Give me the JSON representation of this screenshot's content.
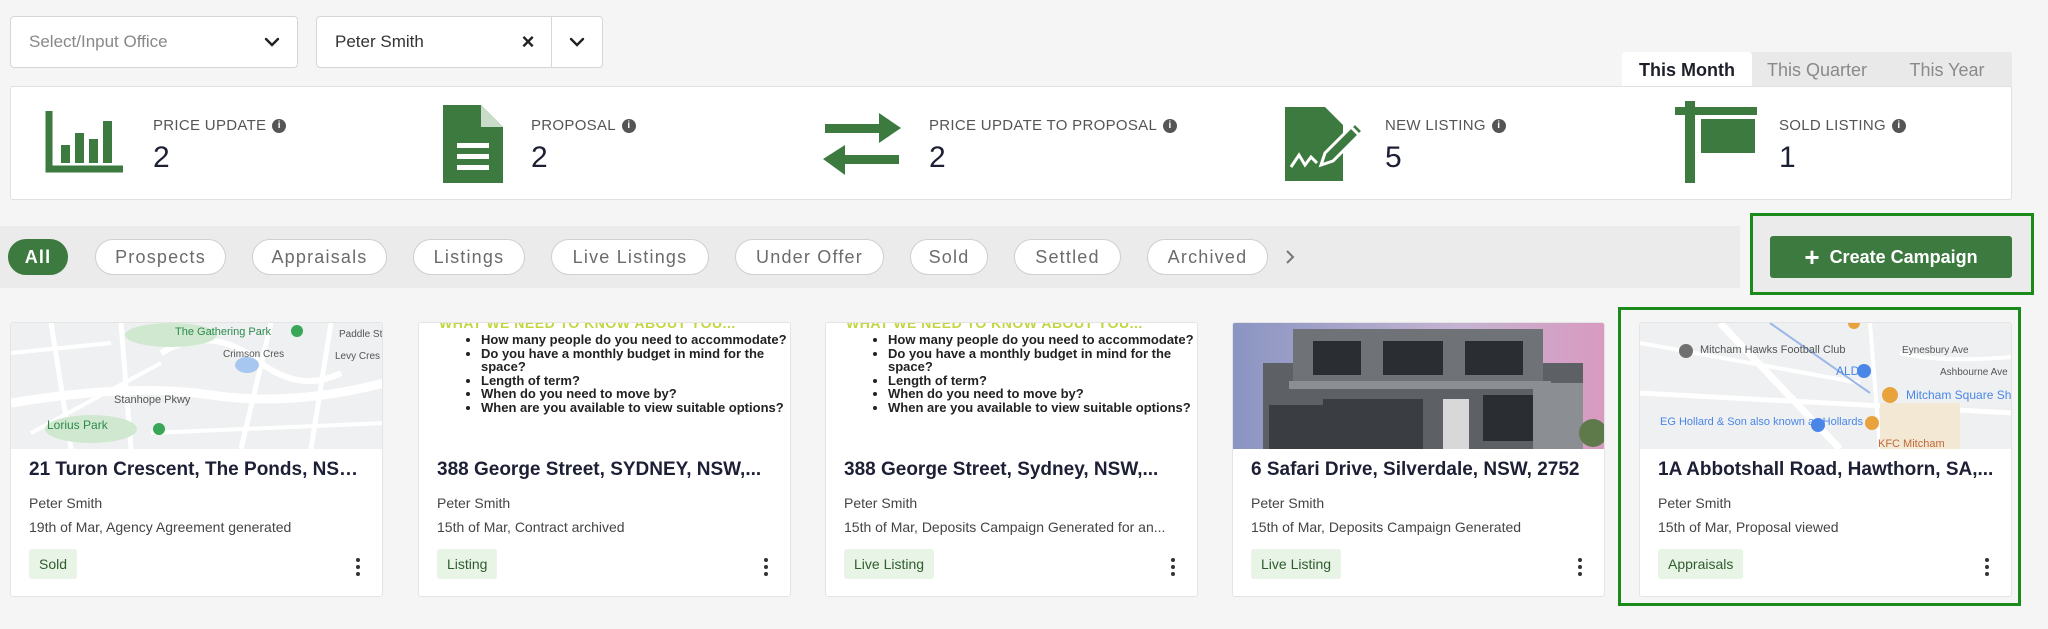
{
  "filters": {
    "office_placeholder": "Select/Input Office",
    "agent_value": "Peter Smith"
  },
  "period_tabs": [
    "This Month",
    "This Quarter",
    "This Year"
  ],
  "stats": [
    {
      "label": "PRICE UPDATE",
      "value": "2",
      "icon": "bar-chart-icon"
    },
    {
      "label": "PROPOSAL",
      "value": "2",
      "icon": "document-icon"
    },
    {
      "label": "PRICE UPDATE TO PROPOSAL",
      "value": "2",
      "icon": "swap-arrows-icon"
    },
    {
      "label": "NEW LISTING",
      "value": "5",
      "icon": "signature-doc-icon"
    },
    {
      "label": "SOLD LISTING",
      "value": "1",
      "icon": "sign-post-icon"
    }
  ],
  "status_tabs": [
    "All",
    "Prospects",
    "Appraisals",
    "Listings",
    "Live Listings",
    "Under Offer",
    "Sold",
    "Settled",
    "Archived"
  ],
  "create_campaign_label": "Create Campaign",
  "doc_thumb": {
    "heading": "WHAT WE NEED TO KNOW ABOUT YOU...",
    "bullets": [
      "How many people do you need to accommodate?",
      "Do you have a monthly budget in mind for the space?",
      "Length of term?",
      "When do you need to move by?",
      "When are you available to view suitable options?"
    ]
  },
  "map1_labels": {
    "park": "The Gathering Park",
    "street1": "Stanhope Pkwy",
    "park2": "Lorius Park",
    "cres": "Crimson Cres",
    "levy": "Levy Cres",
    "paddle": "Paddle St"
  },
  "map2_labels": {
    "club": "Mitcham Hawks Football Club",
    "aldi": "ALDI",
    "mall": "Mitcham Square Shopping Centre",
    "eg": "EG Hollard & Son also known as Hollards",
    "kfc": "KFC Mitcham",
    "eyn": "Eynesbury Ave",
    "ash": "Ashbourne Ave"
  },
  "cards": [
    {
      "title": "21 Turon Crescent, The Ponds, NSW,...",
      "agent": "Peter Smith",
      "activity": "19th of Mar, Agency Agreement generated",
      "tag": "Sold"
    },
    {
      "title": "388 George Street, SYDNEY, NSW,...",
      "agent": "Peter Smith",
      "activity": "15th of Mar, Contract archived",
      "tag": "Listing"
    },
    {
      "title": "388 George Street, Sydney, NSW,...",
      "agent": "Peter Smith",
      "activity": "15th of Mar, Deposits Campaign Generated for an...",
      "tag": "Live Listing"
    },
    {
      "title": "6 Safari Drive, Silverdale, NSW, 2752",
      "agent": "Peter Smith",
      "activity": "15th of Mar, Deposits Campaign Generated",
      "tag": "Live Listing"
    },
    {
      "title": "1A Abbotshall Road, Hawthorn, SA,...",
      "agent": "Peter Smith",
      "activity": "15th of Mar, Proposal viewed",
      "tag": "Appraisals"
    }
  ],
  "colors": {
    "brand": "#3d7a3f",
    "highlight": "#1a8a1a",
    "tag_bg": "#e8f4e5"
  }
}
